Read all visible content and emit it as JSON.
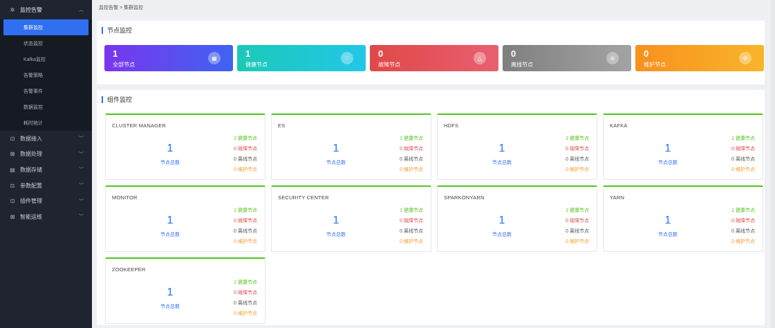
{
  "sidebar": {
    "top": {
      "label": "监控告警"
    },
    "sub_items": [
      "集群监控",
      "状态监控",
      "Kafka监控",
      "告警策略",
      "告警事件",
      "数据监控",
      "耗时统计"
    ],
    "items": [
      {
        "label": "数据接入"
      },
      {
        "label": "数据处理"
      },
      {
        "label": "数据存储"
      },
      {
        "label": "参数配置"
      },
      {
        "label": "插件管理"
      },
      {
        "label": "智能运维"
      }
    ]
  },
  "breadcrumb": "监控告警 > 集群监控",
  "node_panel": {
    "title": "节点监控",
    "cards": [
      {
        "value": "1",
        "label": "全部节点",
        "color": "#6c3ff5"
      },
      {
        "value": "1",
        "label": "健康节点",
        "color": "#1fc8c0"
      },
      {
        "value": "0",
        "label": "故障节点",
        "color": "#e04a55"
      },
      {
        "value": "0",
        "label": "离线节点",
        "color": "#8e8e8e"
      },
      {
        "value": "0",
        "label": "维护节点",
        "color": "#f7a21c"
      }
    ]
  },
  "component_panel": {
    "title": "组件监控",
    "total_label": "节点总数",
    "components": [
      {
        "name": "CLUSTER MANAGER",
        "total": "1",
        "healthy": "1 健康节点",
        "fault": "0 故障节点",
        "offline": "0 离线节点",
        "maintenance": "0 维护节点"
      },
      {
        "name": "ES",
        "total": "1",
        "healthy": "1 健康节点",
        "fault": "0 故障节点",
        "offline": "0 离线节点",
        "maintenance": "0 维护节点"
      },
      {
        "name": "HDFS",
        "total": "1",
        "healthy": "1 健康节点",
        "fault": "0 故障节点",
        "offline": "0 离线节点",
        "maintenance": "0 维护节点"
      },
      {
        "name": "KAFKA",
        "total": "1",
        "healthy": "1 健康节点",
        "fault": "0 故障节点",
        "offline": "0 离线节点",
        "maintenance": "0 维护节点"
      },
      {
        "name": "MONITOR",
        "total": "1",
        "healthy": "1 健康节点",
        "fault": "0 故障节点",
        "offline": "0 离线节点",
        "maintenance": "0 维护节点"
      },
      {
        "name": "SECURITY CENTER",
        "total": "1",
        "healthy": "1 健康节点",
        "fault": "0 故障节点",
        "offline": "0 离线节点",
        "maintenance": "0 维护节点"
      },
      {
        "name": "SPARKONYARN",
        "total": "1",
        "healthy": "1 健康节点",
        "fault": "0 故障节点",
        "offline": "0 离线节点",
        "maintenance": "0 维护节点"
      },
      {
        "name": "YARN",
        "total": "1",
        "healthy": "1 健康节点",
        "fault": "0 故障节点",
        "offline": "0 离线节点",
        "maintenance": "0 维护节点"
      },
      {
        "name": "ZOOKEEPER",
        "total": "1",
        "healthy": "1 健康节点",
        "fault": "0 故障节点",
        "offline": "0 离线节点",
        "maintenance": "0 维护节点"
      }
    ]
  }
}
